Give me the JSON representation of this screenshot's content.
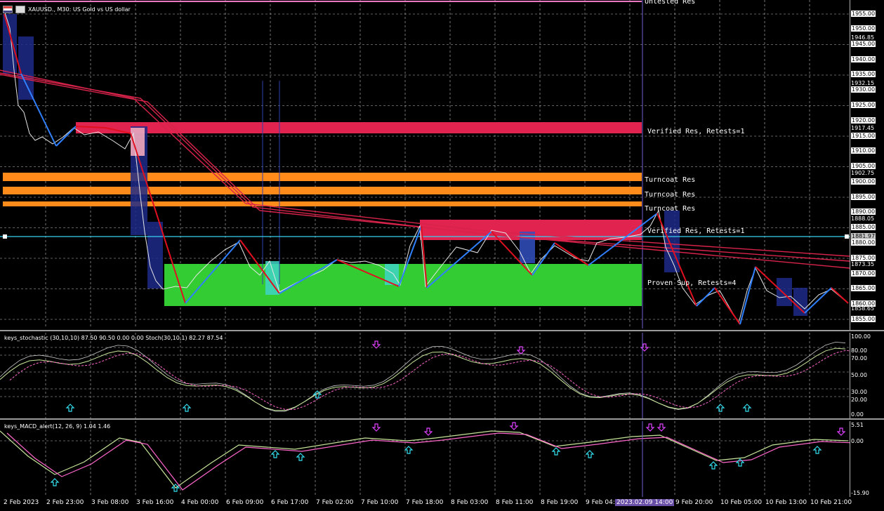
{
  "app": {
    "symbol_title": "XAUUSD., M30:  US Gold vs US dollar",
    "icons": [
      "chart-menu-icon",
      "one-click-trading-icon"
    ]
  },
  "colors": {
    "background": "#000000",
    "grid": "#c0c0c0",
    "resistance_zone": "#e0234f",
    "turncoat_zone": "#ff8c1a",
    "support_zone": "#33cc33",
    "up_segment": "#2f80ff",
    "down_segment": "#e01020",
    "ma_lines": "#d8234a",
    "bid_line": "#36d0f0",
    "stoch_main": "#c6e59a",
    "stoch_signal": "#ff66cc",
    "raw": "#c8c8c8",
    "arrow_up": "#33e0f0",
    "arrow_down": "#e040ff"
  },
  "zones": [
    {
      "label": "Untested Res"
    },
    {
      "label": "Verified Res, Retests=1"
    },
    {
      "label": "Turncoat Res"
    },
    {
      "label": "Turncoat Res"
    },
    {
      "label": "Turncoat Res"
    },
    {
      "label": "Verified Res, Retests=1"
    },
    {
      "label": "Proven Sup, Retests=4"
    }
  ],
  "price_axis": {
    "labels": [
      "1955.00",
      "1950.00",
      "1946.85",
      "1945.00",
      "1940.00",
      "1935.00",
      "1932.15",
      "1930.00",
      "1925.00",
      "1920.00",
      "1917.45",
      "1915.00",
      "1910.00",
      "1905.00",
      "1902.75",
      "1900.00",
      "1895.00",
      "1890.00",
      "1888.05",
      "1885.00",
      "1880.00",
      "1875.00",
      "1873.35",
      "1870.00",
      "1865.00",
      "1860.00",
      "1858.65",
      "1855.00"
    ],
    "boxed": [
      "1955.00",
      "1950.00",
      "1945.00",
      "1940.00",
      "1935.00",
      "1930.00",
      "1925.00",
      "1920.00",
      "1915.00",
      "1910.00",
      "1905.00",
      "1900.00",
      "1895.00",
      "1890.00",
      "1885.00",
      "1880.00",
      "1875.00",
      "1870.00",
      "1865.00",
      "1860.00",
      "1855.00"
    ],
    "current": "1881.97"
  },
  "time_axis": {
    "labels": [
      "2 Feb 2023",
      "2 Feb 23:00",
      "3 Feb 08:00",
      "3 Feb 16:00",
      "4 Feb 00:00",
      "6 Feb 09:00",
      "6 Feb 17:00",
      "7 Feb 02:00",
      "7 Feb 10:00",
      "7 Feb 18:00",
      "8 Feb 03:00",
      "8 Feb 11:00",
      "8 Feb 19:00",
      "9 Feb 04:",
      "2023.02.09 14:00",
      "9 Feb 20:00",
      "10 Feb 05:00",
      "10 Feb 13:00",
      "10 Feb 21:00"
    ],
    "highlight": "2023.02.09 14:00"
  },
  "stochastic": {
    "title": "keys_stochastic (30,10,10) 87.50 90.50 0.00 0.00 Stoch(30,10,1) 82.27 87.54",
    "levels": [
      "100.00",
      "80.00",
      "70.00",
      "50.00",
      "30.00",
      "20.00",
      "0.00"
    ]
  },
  "macd": {
    "title": "keys_MACD_alert(12, 26, 9) 1.04 1.46",
    "levels": [
      "5.51",
      "0.00",
      "-15.90"
    ]
  }
}
